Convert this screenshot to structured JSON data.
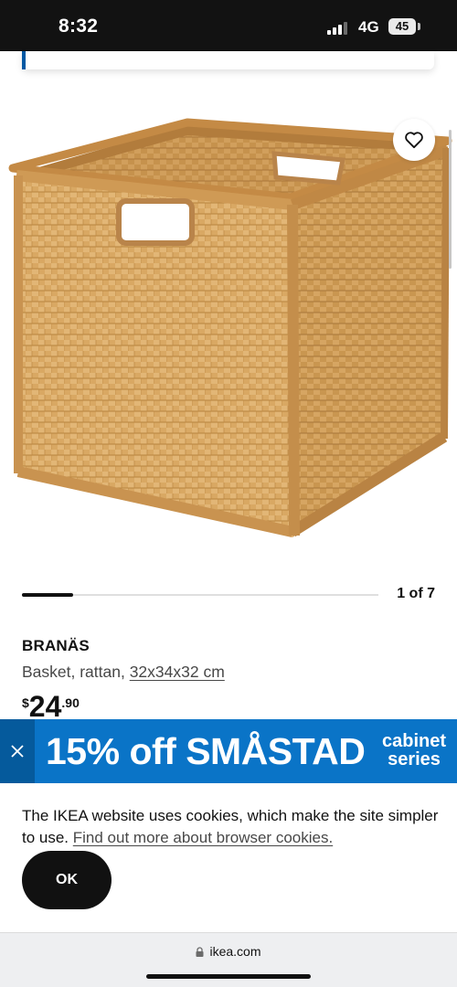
{
  "status_bar": {
    "time": "8:32",
    "network": "4G",
    "battery": "45"
  },
  "product": {
    "wishlist_icon": "heart-outline-icon",
    "carousel_counter": "1 of 7",
    "carousel_position": 1,
    "carousel_total": 7,
    "name": "BRANÄS",
    "description_prefix": "Basket, rattan, ",
    "size": "32x34x32 cm",
    "price_currency": "$",
    "price_integer": "24",
    "price_decimal": ".90"
  },
  "promo_banner": {
    "close_icon": "close-icon",
    "headline": "15% off SMÅSTAD",
    "subline_1": "cabinet",
    "subline_2": "series",
    "color": "#0a74c7"
  },
  "cookie_notice": {
    "text": "The IKEA website uses cookies, which make the site simpler to use. ",
    "link": "Find out more about browser cookies.",
    "ok_label": "OK"
  },
  "browser": {
    "url": "ikea.com",
    "lock_icon": "lock-icon"
  }
}
